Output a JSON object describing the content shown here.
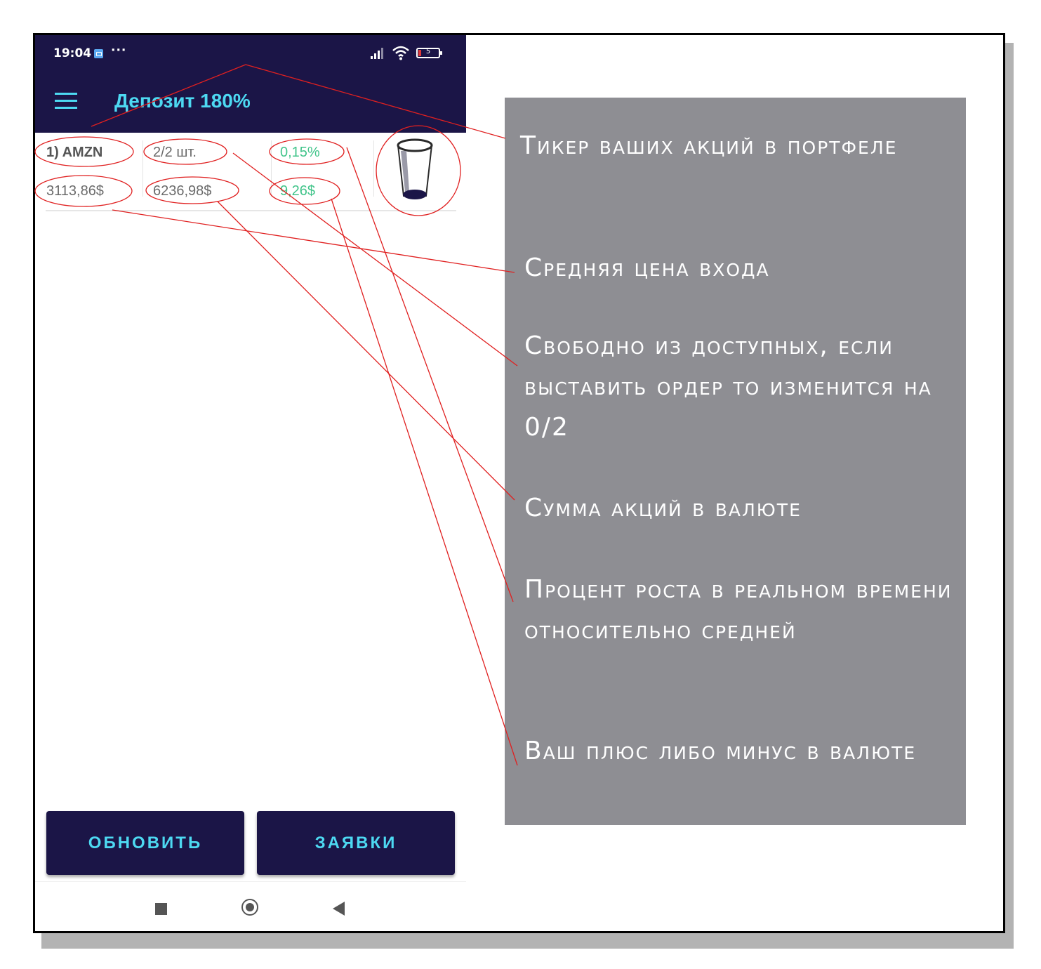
{
  "status_bar": {
    "time": "19:04",
    "dots": "···",
    "battery": "5"
  },
  "app": {
    "title": "Депозит 180%"
  },
  "position_row": {
    "ticker": "1) AMZN",
    "quantity": "2/2 шт.",
    "percent": "0,15%",
    "avg_price": "3113,86$",
    "total": "6236,98$",
    "profit": "9,26$"
  },
  "buttons": {
    "refresh": "ОБНОВИТЬ",
    "orders": "ЗАЯВКИ"
  },
  "annotations": [
    "Тикер ваших акций в портфеле",
    "Средняя цена входа",
    "Свободно из доступных, если выставить ордер то изменится на 0/2",
    "Сумма акций в валюте",
    "Процент роста  в реальном времени относительно средней",
    "Ваш плюс либо минус в валюте"
  ],
  "colors": {
    "appbar": "#1b1547",
    "accent": "#4dd9f2",
    "positive": "#41c48a",
    "panel": "#8e8e93",
    "annotation_lines": "#e02020"
  },
  "icons": [
    "telegram-icon",
    "signal-icon",
    "wifi-icon",
    "battery-icon",
    "menu-icon",
    "glass-icon",
    "nav-recents-icon",
    "nav-home-icon",
    "nav-back-icon"
  ]
}
